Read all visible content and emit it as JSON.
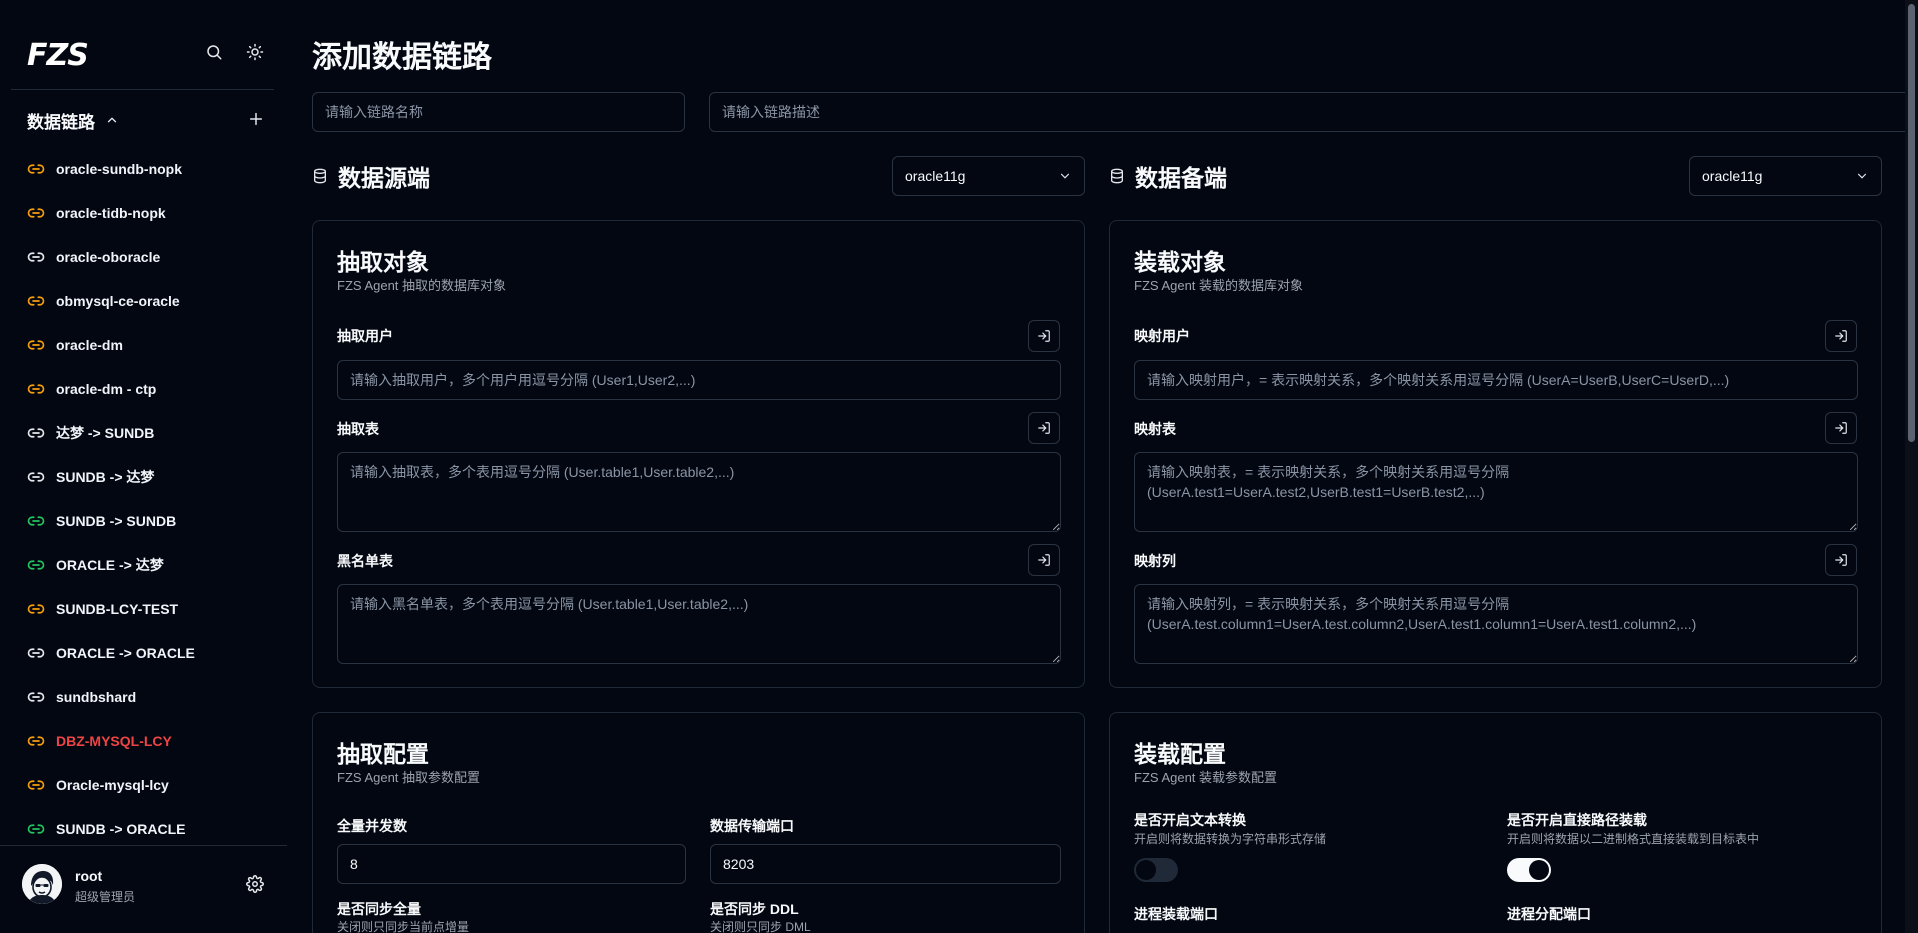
{
  "app": {
    "logo": "FZS",
    "section_title": "数据链路",
    "nav_items": [
      {
        "label": "oracle-sundb-nopk",
        "color": "#f59e0b",
        "active": false
      },
      {
        "label": "oracle-tidb-nopk",
        "color": "#f59e0b",
        "active": false
      },
      {
        "label": "oracle-oboracle",
        "color": "#e5e7eb",
        "active": false
      },
      {
        "label": "obmysql-ce-oracle",
        "color": "#f59e0b",
        "active": false
      },
      {
        "label": "oracle-dm",
        "color": "#f59e0b",
        "active": false
      },
      {
        "label": "oracle-dm - ctp",
        "color": "#f59e0b",
        "active": false
      },
      {
        "label": "达梦 -> SUNDB",
        "color": "#e5e7eb",
        "active": false
      },
      {
        "label": "SUNDB -> 达梦",
        "color": "#e5e7eb",
        "active": false
      },
      {
        "label": "SUNDB -> SUNDB",
        "color": "#22c55e",
        "active": false
      },
      {
        "label": "ORACLE -> 达梦",
        "color": "#22c55e",
        "active": false
      },
      {
        "label": "SUNDB-LCY-TEST",
        "color": "#f59e0b",
        "active": false
      },
      {
        "label": "ORACLE -> ORACLE",
        "color": "#e5e7eb",
        "active": false
      },
      {
        "label": "sundbshard",
        "color": "#e5e7eb",
        "active": false
      },
      {
        "label": "DBZ-MYSQL-LCY",
        "color": "#f59e0b",
        "active": true
      },
      {
        "label": "Oracle-mysql-lcy",
        "color": "#f59e0b",
        "active": false
      },
      {
        "label": "SUNDB -> ORACLE",
        "color": "#22c55e",
        "active": false
      }
    ],
    "user": {
      "name": "root",
      "role": "超级管理员"
    }
  },
  "page": {
    "title": "添加数据链路",
    "name_placeholder": "请输入链路名称",
    "desc_placeholder": "请输入链路描述",
    "source": {
      "title": "数据源端",
      "db_type": "oracle11g",
      "card": {
        "title": "抽取对象",
        "subtitle": "FZS Agent 抽取的数据库对象",
        "user_label": "抽取用户",
        "user_placeholder": "请输入抽取用户，多个用户用逗号分隔 (User1,User2,...)",
        "table_label": "抽取表",
        "table_placeholder": "请输入抽取表，多个表用逗号分隔 (User.table1,User.table2,...)",
        "blacklist_label": "黑名单表",
        "blacklist_placeholder": "请输入黑名单表，多个表用逗号分隔 (User.table1,User.table2,...)"
      },
      "config": {
        "title": "抽取配置",
        "subtitle": "FZS Agent 抽取参数配置",
        "concurrency_label": "全量并发数",
        "concurrency_value": "8",
        "port_label": "数据传输端口",
        "port_value": "8203",
        "sync_full_label": "是否同步全量",
        "sync_full_desc": "关闭则只同步当前点增量",
        "sync_ddl_label": "是否同步 DDL",
        "sync_ddl_desc": "关闭则只同步 DML"
      }
    },
    "target": {
      "title": "数据备端",
      "db_type": "oracle11g",
      "card": {
        "title": "装载对象",
        "subtitle": "FZS Agent 装载的数据库对象",
        "user_label": "映射用户",
        "user_placeholder": "请输入映射用户，= 表示映射关系，多个映射关系用逗号分隔 (UserA=UserB,UserC=UserD,...)",
        "table_label": "映射表",
        "table_placeholder": "请输入映射表，= 表示映射关系，多个映射关系用逗号分隔 (UserA.test1=UserA.test2,UserB.test1=UserB.test2,...)",
        "column_label": "映射列",
        "column_placeholder": "请输入映射列，= 表示映射关系，多个映射关系用逗号分隔 (UserA.test.column1=UserA.test.column2,UserA.test1.column1=UserA.test1.column2,...)"
      },
      "config": {
        "title": "装载配置",
        "subtitle": "FZS Agent 装载参数配置",
        "text_convert_label": "是否开启文本转换",
        "text_convert_desc": "开启则将数据转换为字符串形式存储",
        "text_convert_on": false,
        "direct_path_label": "是否开启直接路径装载",
        "direct_path_desc": "开启则将数据以二进制格式直接装载到目标表中",
        "direct_path_on": true,
        "load_port_label": "进程装载端口",
        "dist_port_label": "进程分配端口"
      }
    }
  }
}
